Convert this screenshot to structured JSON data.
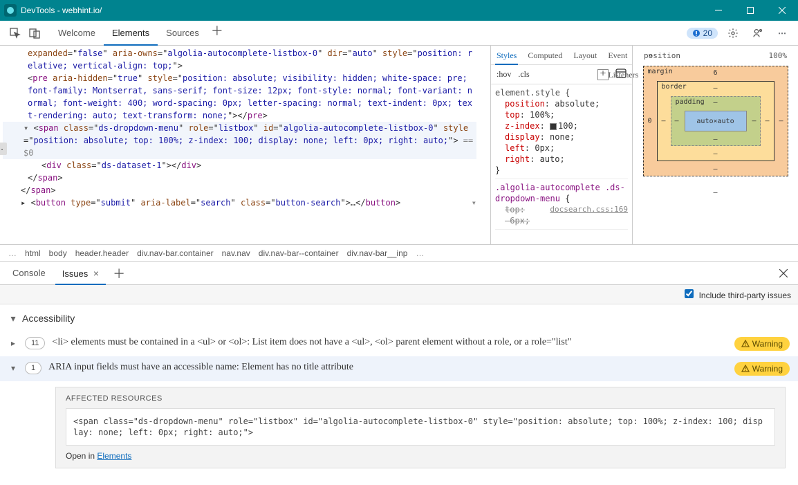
{
  "window": {
    "title": "DevTools - webhint.io/"
  },
  "toolbar": {
    "tabs": [
      "Welcome",
      "Elements",
      "Sources"
    ],
    "active_tab": "Elements",
    "issues_count": "20"
  },
  "dom": {
    "lines": [
      {
        "indent": 3,
        "html": "<span class='tok-attr'>expanded</span>=\"<span class='tok-val'>false</span>\" <span class='tok-attr'>aria-owns</span>=\"<span class='tok-val'>algolia-autocomplete-listbox-0</span>\" <span class='tok-attr'>dir</span>=\"<span class='tok-val'>auto</span>\" <span class='tok-attr'>style</span>=\"<span class='tok-val'>position: relative; vertical-align: top;</span>\"&gt;"
      },
      {
        "indent": 3,
        "html": "&lt;<span class='tok-tag'>pre</span> <span class='tok-attr'>aria-hidden</span>=\"<span class='tok-val'>true</span>\" <span class='tok-attr'>style</span>=\"<span class='tok-val'>position: absolute; visibility: hidden; white-space: pre; font-family: Montserrat, sans-serif; font-size: 12px; font-style: normal; font-variant: normal; font-weight: 400; word-spacing: 0px; letter-spacing: normal; text-indent: 0px; text-rendering: auto; text-transform: none;</span>\"&gt;&lt;/<span class='tok-tag'>pre</span>&gt;"
      },
      {
        "indent": 3,
        "hl": true,
        "html": "<span style='color:#666'>▾ </span>&lt;<span class='tok-tag'>span</span> <span class='tok-attr'>class</span>=\"<span class='tok-val'>ds-dropdown-menu</span>\" <span class='tok-attr'>role</span>=\"<span class='tok-val'>listbox</span>\" <span class='tok-attr'>id</span>=\"<span class='tok-val'>algolia-autocomplete-listbox-0</span>\" <span class='tok-attr'>style</span>=\"<span class='tok-val'>position: absolute; top: 100%; z-index: 100; display: none; left: 0px; right: auto;</span>\"&gt; <span class='tok-gray'>== $0</span>"
      },
      {
        "indent": 5,
        "html": "&lt;<span class='tok-tag'>div</span> <span class='tok-attr'>class</span>=\"<span class='tok-val'>ds-dataset-1</span>\"&gt;&lt;/<span class='tok-tag'>div</span>&gt;"
      },
      {
        "indent": 3,
        "html": "&lt;/<span class='tok-tag'>span</span>&gt;"
      },
      {
        "indent": 2,
        "html": "&lt;/<span class='tok-tag'>span</span>&gt;"
      },
      {
        "indent": 2,
        "html": "▸ &lt;<span class='tok-tag'>button</span> <span class='tok-attr'>type</span>=\"<span class='tok-val'>submit</span>\" <span class='tok-attr'>aria-label</span>=\"<span class='tok-val'>search</span>\" <span class='tok-attr'>class</span>=\"<span class='tok-val'>button-search</span>\"&gt;…&lt;/<span class='tok-tag'>button</span>&gt; <span style='float:right;color:#888'>▾</span>"
      }
    ],
    "selector_left": "..."
  },
  "styles": {
    "tabs": [
      "Styles",
      "Computed",
      "Layout",
      "Event Listeners"
    ],
    "active": "Styles",
    "filters": {
      "hov": ":hov",
      "cls": ".cls"
    },
    "rules": [
      {
        "selector": "element.style {",
        "props": [
          "position: absolute;",
          "top: 100%;",
          "z-index: ▣100;",
          "display: none;",
          "left: 0px;",
          "right: auto;"
        ],
        "close": "}"
      },
      {
        "selector": ".algolia-autocomplete .ds-dropdown-menu {",
        "link": "docsearch.css:169",
        "props": [
          "<del>top: -6px;</del>"
        ],
        "partial": true
      }
    ]
  },
  "boxmodel": {
    "position": "position",
    "width": "100%",
    "margin_label": "margin",
    "border_label": "border",
    "padding_label": "padding",
    "content": "auto×auto",
    "margin_top": "6",
    "dash": "–",
    "zero": "0"
  },
  "breadcrumb": [
    "html",
    "body",
    "header.header",
    "div.nav-bar.container",
    "nav.nav",
    "div.nav-bar--container",
    "div.nav-bar__inp"
  ],
  "drawer": {
    "tabs": [
      {
        "label": "Console",
        "active": false,
        "closable": false
      },
      {
        "label": "Issues",
        "active": true,
        "closable": true
      }
    ],
    "include3rd": "Include third-party issues",
    "group": "Accessibility",
    "issues": [
      {
        "count": "11",
        "text": "<li> elements must be contained in a <ul> or <ol>: List item does not have a <ul>, <ol> parent element without a role, or a role=\"list\"",
        "badge": "Warning",
        "expanded": false
      },
      {
        "count": "1",
        "text": "ARIA input fields must have an accessible name: Element has no title attribute",
        "badge": "Warning",
        "expanded": true
      }
    ],
    "resources": {
      "heading": "AFFECTED RESOURCES",
      "code": "<span class=\"ds-dropdown-menu\" role=\"listbox\" id=\"algolia-autocomplete-listbox-0\" style=\"position: absolute; top: 100%; z-index: 100; display: none; left: 0px; right: auto;\">",
      "open": "Open in ",
      "link": "Elements"
    }
  }
}
